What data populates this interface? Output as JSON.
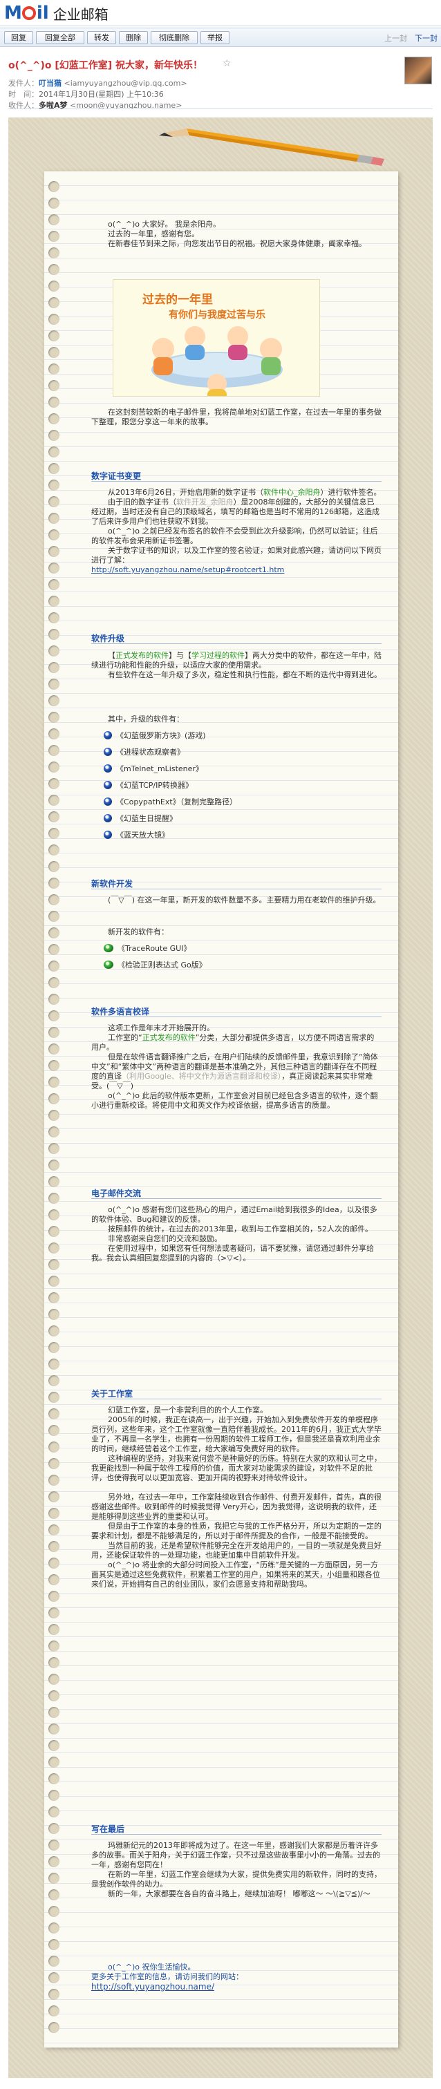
{
  "app": {
    "brand_m": "M",
    "brand_il": "il",
    "brand_cn": "企业邮箱"
  },
  "toolbar": {
    "buttons": [
      "回复",
      "回复全部",
      "转发",
      "删除",
      "彻底删除",
      "举报"
    ],
    "prev": "上一封",
    "next": "下一封"
  },
  "mail": {
    "subject": "o(^_^)o [幻蓝工作室] 祝大家，新年快乐！",
    "star": "☆",
    "from_label": "发件人：",
    "from_name": "叮当猫",
    "from_email": "<iamyuyangzhou@vip.qq.com>",
    "time_label": "时　间：",
    "time": "2014年1月30日(星期四) 上午10:36",
    "to_label": "收件人：",
    "to_name": "多啦A梦",
    "to_email": "<moon@yuyangzhou.name>"
  },
  "intro": {
    "p1": "o(^_^)o 大家好。 我是余阳舟。",
    "p2": "过去的一年里，感谢有您。",
    "p3": "在新春佳节到来之际，向您发出节日的祝福。祝愿大家身体健康，阖家幸福。",
    "illus_cap1": "过去的一年里",
    "illus_cap2": "有你们与我度过苦与乐",
    "p4": "在这封刻苦较新的电子邮件里，我将简单地对幻蓝工作室，在过去一年里的事务做下整理，跟您分享这一年来的故事。"
  },
  "sections": {
    "cert": {
      "title": "数字证书变更",
      "p1a": "从2013年6月26日，开始启用新的数字证书（",
      "p1b": "软件中心_余阳舟",
      "p1c": "）进行软件签名。",
      "p2a": "由于旧的数字证书（",
      "p2b": "软件开发_余阳舟",
      "p2c": "）是2008年创建的，大部分的关键信息已经过期，当时还没有自己的顶级域名，填写的邮箱也是当时不常用的126邮箱，这造成了后来许多用户们也往获取不到我。",
      "p3": "o(^_^)o 之前已经发布签名的软件不会受到此次升级影响，仍然可以验证；往后的软件发布会采用新证书签署。",
      "p4": "关于数字证书的知识，以及工作室的签名验证，如果对此感兴趣，请访问以下网页进行了解：",
      "link": "http://soft.yuyangzhou.name/setup#rootcert1.htm"
    },
    "upgrade": {
      "title": "软件升级",
      "p1a": "【",
      "p1b": "正式发布的软件",
      "p1c": "】与【",
      "p1d": "学习过程的软件",
      "p1e": "】两大分类中的软件，都在这一年中，陆续进行功能和性能的升级，以适应大家的使用需求。",
      "p2": "有些软件在这一年升级了多次，稳定性和执行性能，都在不断的迭代中得到进化。",
      "list_title": "其中，升级的软件有：",
      "items": [
        "《幻蓝俄罗斯方块》(游戏)",
        "《进程状态观察者》",
        "《mTelnet_mListener》",
        "《幻蓝TCP/IP转换器》",
        "《CopypathExt》（复制完整路径）",
        "《幻蓝生日提醒》",
        "《蓝天放大镜》"
      ]
    },
    "newsoft": {
      "title": "新软件开发",
      "p1": "(￣▽￣) 在这一年里，新开发的软件数量不多。主要精力用在老软件的维护升级。",
      "list_title": "新开发的软件有：",
      "items": [
        "《TraceRoute GUI》",
        "《检验正则表达式 Go版》"
      ]
    },
    "i18n": {
      "title": "软件多语言校译",
      "p1": "这项工作是年末才开始展开的。",
      "p2a": "工作室的“",
      "p2b": "正式发布的软件",
      "p2c": "”分类，大部分都提供多语言，以方便不同语言需求的用户。",
      "p3a": "但是在软件语言翻译推广之后，在用户们陆续的反馈邮件里，我意识到除了“简体中文”和“繁体中文”两种语言的翻译是基本准确之外，其他三种语言的翻译存在不同程度的直译",
      "p3b": "（利用Google、将中文作为源语言翻译和校译）",
      "p3c": "，真正阅读起来其实非常难受。(￣▽￣)",
      "p4": "o(^_^)o 此后的软件版本更新，工作室会对目前已经包含多语言的软件，逐个翻小进行重新校译。将使用中文和英文作为校译依据，提高多语言的质量。"
    },
    "mail": {
      "title": "电子邮件交流",
      "p1": "o(^_^)o 感谢有您们这些热心的用户，通过Email给到我很多的Idea，以及很多的软件体验、Bug和建议的反馈。",
      "p2": "按照邮件的统计，在过去的2013年里，收到与工作室相关的，52人次的邮件。",
      "p3": "非常感谢来自您们的交流和鼓励。",
      "p4": "在使用过程中，如果您有任何想法或者疑问，请不要犹豫，请您通过邮件分享给我。我会认真细回复您提到的内容的（>▽<）。"
    },
    "about": {
      "title": "关于工作室",
      "p1": "幻蓝工作室，是一个非营利目的的个人工作室。",
      "p2": "2005年的时候，我正在读高一，出于兴趣，开始加入到免费软件开发的单模程序员行列，这些年来，这个工作室就像一直陪伴着我成长。2011年的6月，我正式大学毕业了，不再是一名学生，也拥有一份周期的软件工程师工作，但是我还是喜欢利用业余的时间，继续经营着这个工作室，给大家编写免费好用的软件。",
      "p3": "这种编程的坚持，对我来说何尝不是种最好的历练。特别在大家的欢和认可之中，我更能找到一种属于软件工程师的价值，而大家对功能需求的建设，对软件不足的批评，也使得我可以以更加宽容、更加开阔的视野来对待软件设计。",
      "p4": "另外地，在过去一年中，工作室陆续收到合作邮件、付费开发邮件，首先，真的很感谢这些邮件。收到邮件的时候我觉得 Very开心，因为我觉得，这说明我的软件，还是能够得到这些业界的重要和认可。",
      "p5": "但是由于工作室的本身的性质，我把它与我的工作严格分开，所以为定期的一定的要求和计划，都是不能够满足的，所以对于邮件所提及的合作，一般是不能接受的。",
      "p6": "当然目前的我，还是希望软件能够完全在开发给用户的，一目的一项就是免费且好用，还能保证软件的一处理功能，也能更加集中目前软件开发。",
      "p7": "o(^_^)o 将业余的大部分时间投入工作室，“历练”是关键的一方面原因，另一方面其实是通过这些免费软件，积累着工作室的用户，如果将来的某天，小组量和跟各位来们说，开始拥有自己的创业团队，家们会愿意支持和帮助我吗。"
    },
    "closing": {
      "title": "写在最后",
      "p1": "玛雅新纪元的2013年即将成为过了。在这一年里，感谢我们大家都是历着许许多多的故事。而关于阳舟，关于幻蓝工作室，只不过是这些故事里小小的一角落。过去的一年，感谢有您同在！",
      "p2": "在新的一年里，幻蓝工作室会继续为大家，提供免费实用的新软件，同时的支持，是我创作软件的动力。",
      "p3": "新的一年，大家都要在各自的奋斗路上，继续加油呀！ 嘟嘟这～ ～\\(≧▽≦)/～"
    },
    "footer": {
      "l1": "o(^_^)o 祝你生活愉快。",
      "l2": "更多关于工作室的信息，请访问我们的网站：",
      "link": "http://soft.yuyangzhou.name/"
    }
  },
  "colors": {
    "accent": "#1d5fb0",
    "subject": "#cc3333",
    "section_title": "#2155b0",
    "green_text": "#2a9a2a",
    "paper": "#fbfbf3",
    "frame": "#ddd5be"
  }
}
